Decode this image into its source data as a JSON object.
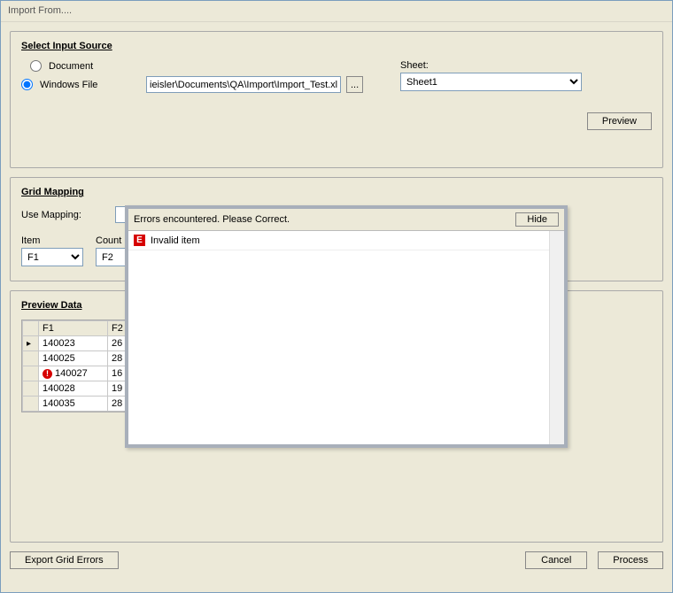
{
  "title": "Import From....",
  "input_source": {
    "heading": "Select Input Source",
    "radio_document": "Document",
    "radio_windows_file": "Windows File",
    "selected": "windows_file",
    "file_path": "ieisler\\Documents\\QA\\Import\\Import_Test.xlsx",
    "browse_label": "...",
    "sheet_label": "Sheet:",
    "sheet_value": "Sheet1",
    "preview_button": "Preview"
  },
  "grid_mapping": {
    "heading": "Grid Mapping",
    "use_mapping_label": "Use Mapping:",
    "use_mapping_value": "",
    "fields": {
      "item_label": "Item",
      "item_value": "F1",
      "count_label": "Count",
      "count_value": "F2"
    }
  },
  "preview_data": {
    "heading": "Preview Data",
    "columns": [
      "F1",
      "F2"
    ],
    "rows": [
      {
        "ptr": true,
        "err": false,
        "f1": "140023",
        "f2": "26"
      },
      {
        "ptr": false,
        "err": false,
        "f1": "140025",
        "f2": "28"
      },
      {
        "ptr": false,
        "err": true,
        "f1": "140027",
        "f2": "16"
      },
      {
        "ptr": false,
        "err": false,
        "f1": "140028",
        "f2": "19"
      },
      {
        "ptr": false,
        "err": false,
        "f1": "140035",
        "f2": "28"
      }
    ]
  },
  "error_dialog": {
    "header": "Errors encountered.  Please Correct.",
    "hide_button": "Hide",
    "items": [
      {
        "badge": "E",
        "text": "Invalid item"
      }
    ]
  },
  "bottom": {
    "export_errors": "Export Grid Errors",
    "cancel": "Cancel",
    "process": "Process"
  }
}
